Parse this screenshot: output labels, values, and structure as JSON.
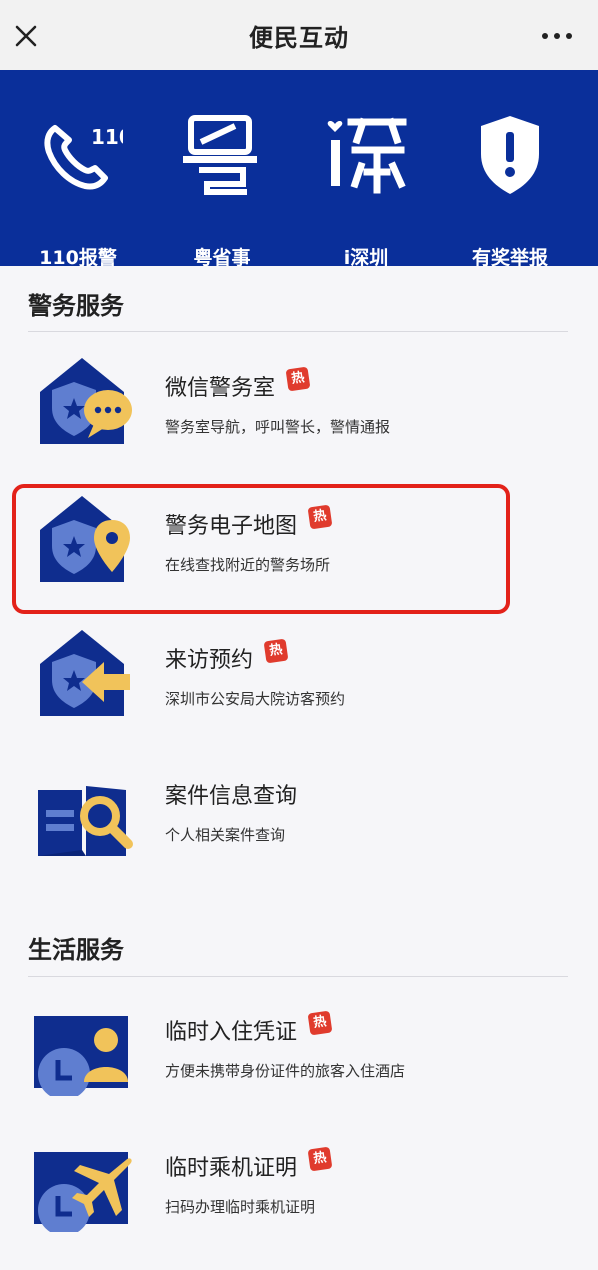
{
  "header": {
    "title": "便民互动",
    "close_icon": "close-icon",
    "more_icon": "more-icon"
  },
  "quick_actions": [
    {
      "label": "110报警",
      "icon": "phone-110-icon"
    },
    {
      "label": "粤省事",
      "icon": "yue-sheng-shi-icon"
    },
    {
      "label": "i深圳",
      "icon": "i-shenzhen-icon"
    },
    {
      "label": "有奖举报",
      "icon": "shield-report-icon"
    }
  ],
  "police_services": {
    "title": "警务服务",
    "items": [
      {
        "name": "微信警务室",
        "desc": "警务室导航，呼叫警长，警情通报",
        "hot": "热",
        "icon": "police-chat-icon"
      },
      {
        "name": "警务电子地图",
        "desc": "在线查找附近的警务场所",
        "hot": "热",
        "icon": "police-map-icon"
      },
      {
        "name": "来访预约",
        "desc": "深圳市公安局大院访客预约",
        "hot": "热",
        "icon": "visit-appointment-icon"
      },
      {
        "name": "案件信息查询",
        "desc": "个人相关案件查询",
        "icon": "case-search-icon"
      }
    ]
  },
  "life_services": {
    "title": "生活服务",
    "items": [
      {
        "name": "临时入住凭证",
        "desc": "方便未携带身份证件的旅客入住酒店",
        "hot": "热",
        "icon": "temp-checkin-icon"
      },
      {
        "name": "临时乘机证明",
        "desc": "扫码办理临时乘机证明",
        "hot": "热",
        "icon": "temp-boarding-icon"
      }
    ]
  },
  "colors": {
    "banner_blue": "#0a2f9a",
    "icon_blue": "#0f2d8e",
    "icon_light_blue": "#5f7ed0",
    "icon_gold": "#f1c35a",
    "hot_red": "#e03b2d",
    "highlight_red": "#e3221a"
  }
}
